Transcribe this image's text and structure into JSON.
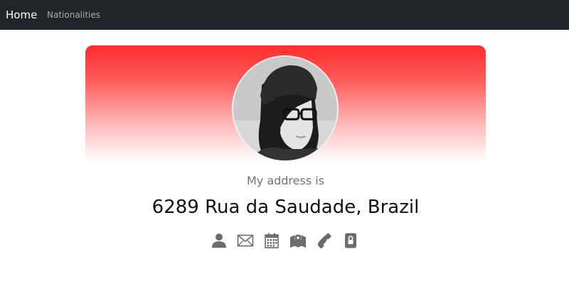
{
  "navbar": {
    "brand": "Home",
    "links": [
      "Nationalities"
    ]
  },
  "profile": {
    "gradient_colors": [
      "#fe2d2d",
      "#ffffff"
    ],
    "label": "My address is",
    "value": "6289 Rua da Saudade, Brazil",
    "icon_color": "#6c6c6c",
    "icons": [
      "user-icon",
      "envelope-icon",
      "calendar-icon",
      "map-icon",
      "phone-icon",
      "lock-icon"
    ]
  }
}
